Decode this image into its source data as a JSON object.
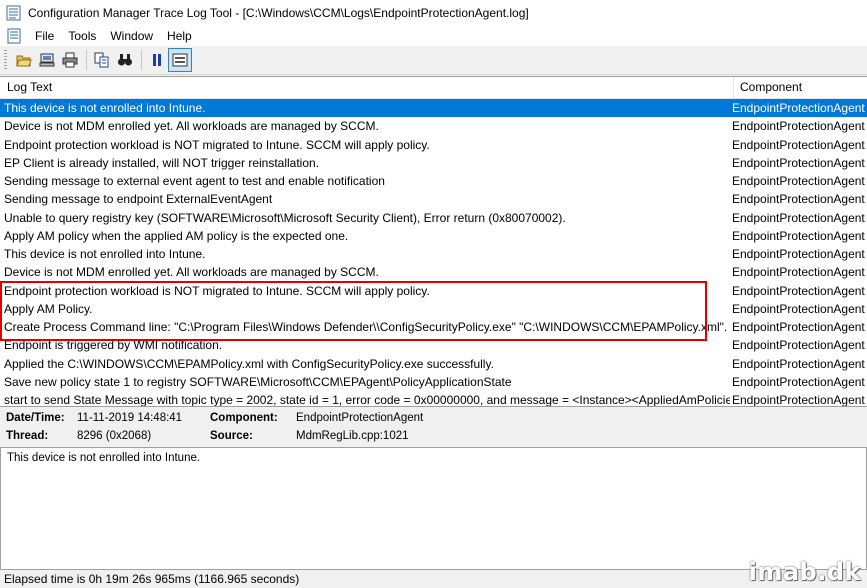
{
  "window": {
    "title": "Configuration Manager Trace Log Tool - [C:\\Windows\\CCM\\Logs\\EndpointProtectionAgent.log]"
  },
  "menu": {
    "items": [
      "File",
      "Tools",
      "Window",
      "Help"
    ]
  },
  "toolbar": {
    "buttons": [
      "open-icon",
      "open-on-server-icon",
      "print-icon",
      "copy-icon",
      "find-icon",
      "pause-icon",
      "highlight-icon"
    ]
  },
  "log": {
    "columns": {
      "text": "Log Text",
      "component": "Component"
    },
    "rows": [
      {
        "text": "This device is not enrolled into Intune.",
        "component": "EndpointProtectionAgent"
      },
      {
        "text": "Device is not MDM enrolled yet. All workloads are managed by SCCM.",
        "component": "EndpointProtectionAgent"
      },
      {
        "text": "Endpoint protection workload is NOT migrated to Intune. SCCM will apply policy.",
        "component": "EndpointProtectionAgent"
      },
      {
        "text": "EP Client is already installed, will NOT trigger reinstallation.",
        "component": "EndpointProtectionAgent"
      },
      {
        "text": "Sending message to external event agent to test and enable notification",
        "component": "EndpointProtectionAgent"
      },
      {
        "text": "Sending message to endpoint ExternalEventAgent",
        "component": "EndpointProtectionAgent"
      },
      {
        "text": "Unable to query registry key (SOFTWARE\\Microsoft\\Microsoft Security Client), Error return (0x80070002).",
        "component": "EndpointProtectionAgent"
      },
      {
        "text": "Apply AM policy when the applied AM policy is the expected one.",
        "component": "EndpointProtectionAgent"
      },
      {
        "text": "This device is not enrolled into Intune.",
        "component": "EndpointProtectionAgent"
      },
      {
        "text": "Device is not MDM enrolled yet. All workloads are managed by SCCM.",
        "component": "EndpointProtectionAgent"
      },
      {
        "text": "Endpoint protection workload is NOT migrated to Intune. SCCM will apply policy.",
        "component": "EndpointProtectionAgent"
      },
      {
        "text": "Apply AM Policy.",
        "component": "EndpointProtectionAgent"
      },
      {
        "text": "Create Process Command line: \"C:\\Program Files\\Windows Defender\\\\ConfigSecurityPolicy.exe\" \"C:\\WINDOWS\\CCM\\EPAMPolicy.xml\".",
        "component": "EndpointProtectionAgent"
      },
      {
        "text": "Endpoint is triggered by WMI notification.",
        "component": "EndpointProtectionAgent"
      },
      {
        "text": "Applied the C:\\WINDOWS\\CCM\\EPAMPolicy.xml with ConfigSecurityPolicy.exe successfully.",
        "component": "EndpointProtectionAgent"
      },
      {
        "text": "Save new policy state 1 to registry SOFTWARE\\Microsoft\\CCM\\EPAgent\\PolicyApplicationState",
        "component": "EndpointProtectionAgent"
      },
      {
        "text": "start to send State Message with topic type = 2002, state id = 1, error code = 0x00000000, and message = <Instance><AppliedAmPolicies><",
        "component": "EndpointProtectionAgent"
      }
    ]
  },
  "details": {
    "datetime_label": "Date/Time:",
    "datetime_value": "11-11-2019 14:48:41",
    "component_label": "Component:",
    "component_value": "EndpointProtectionAgent",
    "thread_label": "Thread:",
    "thread_value": "8296 (0x2068)",
    "source_label": "Source:",
    "source_value": "MdmRegLib.cpp:1021",
    "message": "This device is not enrolled into Intune."
  },
  "status": {
    "elapsed": "Elapsed time is 0h 19m 26s 965ms (1166.965 seconds)"
  },
  "watermark": "imab.dk",
  "colors": {
    "selection": "#0078d7",
    "highlight_box": "#e00000"
  }
}
